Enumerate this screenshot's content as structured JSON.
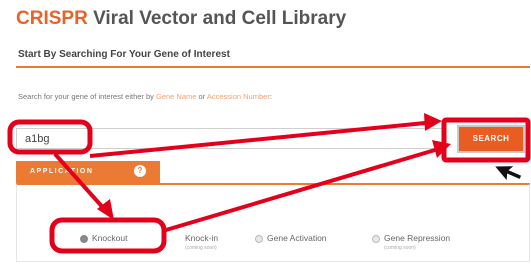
{
  "header": {
    "title_brand": "CRISPR",
    "title_rest": " Viral Vector and Cell Library"
  },
  "section": {
    "title": "Start By Searching For Your Gene of Interest"
  },
  "intro": {
    "text_before": "Search for your gene of interest either by ",
    "link_gene_name": "Gene Name",
    "text_middle": " or ",
    "link_accession": "Accession Number",
    "text_after": ":"
  },
  "search": {
    "value": "a1bg",
    "button_label": "SEARCH"
  },
  "application_tab": {
    "label": "APPLICATION",
    "info_icon": "info-icon"
  },
  "options": [
    {
      "label": "Knockout",
      "selected": true
    },
    {
      "label": "Knock-in",
      "subtext": "(coming soon)",
      "selected": false
    },
    {
      "label": "Gene Activation",
      "selected": false
    },
    {
      "label": "Gene Repression",
      "subtext": "(coming soon)",
      "selected": false
    }
  ],
  "colors": {
    "accent": "#ea7a34",
    "search_button": "#ea5d22",
    "annotation": "#e3001b"
  }
}
